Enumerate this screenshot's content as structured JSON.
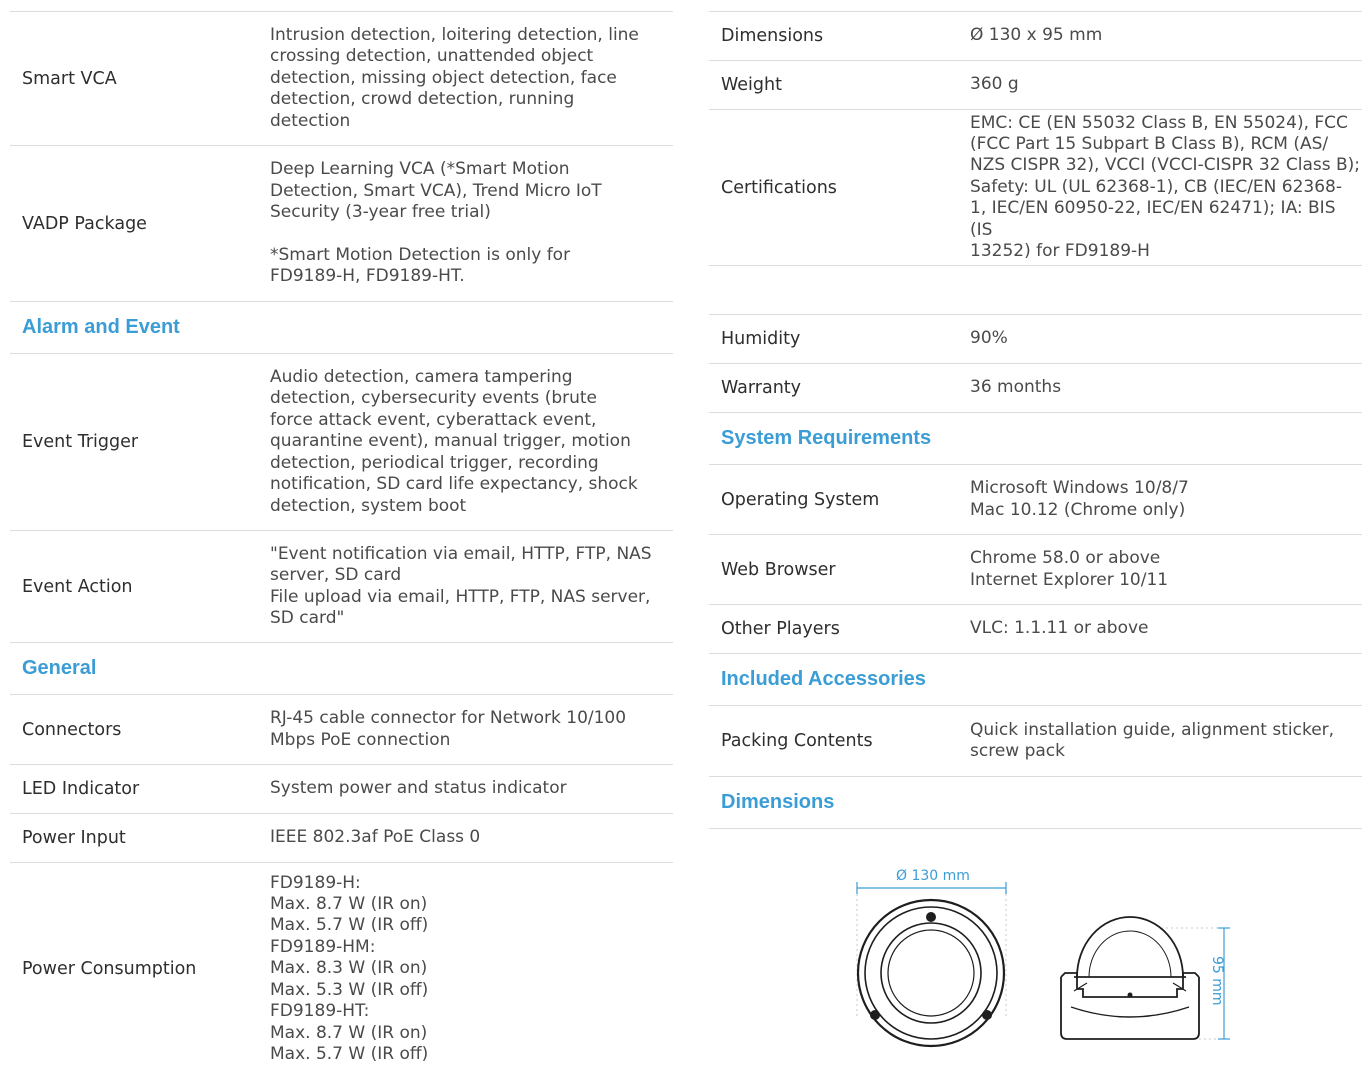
{
  "left": {
    "smart_vca": {
      "label": "Smart VCA",
      "value": "Intrusion detection, loitering detection, line\ncrossing detection, unattended object\ndetection, missing object detection, face\ndetection, crowd detection, running\ndetection"
    },
    "vadp": {
      "label": "VADP Package",
      "value": "Deep Learning VCA (*Smart Motion\nDetection, Smart VCA), Trend Micro IoT\nSecurity (3-year free trial)\n\n*Smart Motion Detection is only for\nFD9189-H, FD9189-HT."
    },
    "alarm_heading": "Alarm and Event",
    "event_trigger": {
      "label": "Event Trigger",
      "value": "Audio detection, camera tampering\ndetection, cybersecurity events (brute\nforce attack event, cyberattack event,\nquarantine event), manual trigger, motion\ndetection, periodical trigger, recording\nnotification, SD card life expectancy, shock\ndetection, system boot"
    },
    "event_action": {
      "label": "Event Action",
      "value": "\"Event notification via email, HTTP, FTP, NAS\nserver, SD card\nFile upload via email, HTTP, FTP, NAS server,\nSD card\""
    },
    "general_heading": "General",
    "connectors": {
      "label": "Connectors",
      "value": "RJ-45 cable connector for Network 10/100\nMbps PoE connection"
    },
    "led": {
      "label": "LED Indicator",
      "value": "System power and status indicator"
    },
    "power_input": {
      "label": "Power Input",
      "value": "IEEE 802.3af PoE Class 0"
    },
    "power_consumption": {
      "label": "Power Consumption",
      "value": "FD9189-H:\nMax. 8.7 W (IR on)\nMax. 5.7 W (IR off)\nFD9189-HM:\nMax. 8.3 W (IR on)\nMax. 5.3 W (IR off)\nFD9189-HT:\nMax. 8.7 W (IR on)\nMax. 5.7 W (IR off)"
    }
  },
  "right": {
    "dimensions": {
      "label": "Dimensions",
      "value": "Ø 130 x 95 mm"
    },
    "weight": {
      "label": "Weight",
      "value": "360 g"
    },
    "certifications": {
      "label": "Certifications",
      "value": "EMC: CE (EN 55032 Class B, EN 55024), FCC\n(FCC Part 15 Subpart B Class B), RCM (AS/\nNZS CISPR 32), VCCI (VCCI-CISPR 32 Class B);\nSafety: UL (UL 62368-1), CB (IEC/EN 62368-\n1, IEC/EN 60950-22, IEC/EN 62471); IA: BIS (IS\n13252) for FD9189-H"
    },
    "humidity": {
      "label": "Humidity",
      "value": "90%"
    },
    "warranty": {
      "label": "Warranty",
      "value": "36 months"
    },
    "sysreq_heading": "System Requirements",
    "os": {
      "label": "Operating System",
      "value": "Microsoft Windows 10/8/7\nMac 10.12 (Chrome only)"
    },
    "browser": {
      "label": "Web Browser",
      "value": "Chrome 58.0 or above\nInternet Explorer 10/11"
    },
    "players": {
      "label": "Other Players",
      "value": "VLC: 1.1.11 or above"
    },
    "accessories_heading": "Included Accessories",
    "packing": {
      "label": "Packing Contents",
      "value": "Quick installation guide, alignment sticker,\nscrew pack"
    },
    "dimensions_heading": "Dimensions"
  },
  "drawing": {
    "width_label": "Ø 130 mm",
    "height_label": "95 mm",
    "accent_color": "#3b9dd6"
  }
}
